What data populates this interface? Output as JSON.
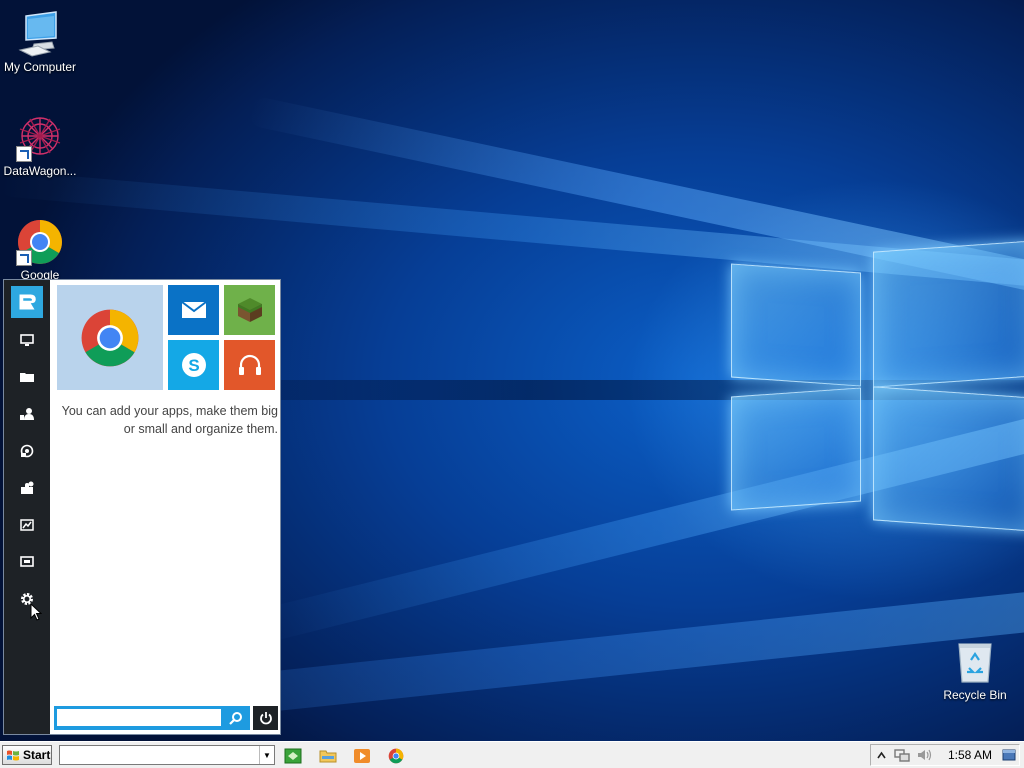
{
  "desktop": {
    "icons": [
      {
        "label": "My Computer"
      },
      {
        "label": "DataWagon..."
      },
      {
        "label": "Google"
      },
      {
        "label": "Recycle Bin"
      }
    ]
  },
  "start_menu": {
    "rail_items": [
      {
        "name": "logo",
        "icon": "app-logo-icon"
      },
      {
        "name": "computer",
        "icon": "monitor-icon"
      },
      {
        "name": "documents",
        "icon": "folder-icon"
      },
      {
        "name": "users",
        "icon": "user-icon"
      },
      {
        "name": "control-panel",
        "icon": "network-icon"
      },
      {
        "name": "programs",
        "icon": "puzzle-icon"
      },
      {
        "name": "performance",
        "icon": "chart-icon"
      },
      {
        "name": "display",
        "icon": "screen-icon"
      },
      {
        "name": "settings",
        "icon": "gear-icon"
      }
    ],
    "tiles": [
      {
        "name": "chrome",
        "icon": "chrome-icon",
        "color": "#b9d3ec"
      },
      {
        "name": "mail",
        "icon": "mail-icon",
        "color": "#0a72c6"
      },
      {
        "name": "minecraft",
        "icon": "minecraft-icon",
        "color": "#6fb14a"
      },
      {
        "name": "skype",
        "icon": "skype-icon",
        "color": "#14a8e6"
      },
      {
        "name": "music",
        "icon": "headphones-icon",
        "color": "#e2572a"
      }
    ],
    "hint_text": "You can add your apps, make them big or small and organize them.",
    "search": {
      "value": "",
      "placeholder": ""
    }
  },
  "taskbar": {
    "start_label": "Start",
    "address_value": "",
    "quick_launch": [
      "show-desktop-icon",
      "explorer-icon",
      "media-player-icon",
      "chrome-icon"
    ],
    "tray_icons": [
      "chevron-up-icon",
      "network-icon",
      "volume-icon",
      "show-desktop-icon"
    ],
    "clock": "1:58 AM"
  },
  "colors": {
    "wallpaper_blue": "#063e96",
    "accent": "#1e9be0",
    "rail": "#1e2226"
  }
}
